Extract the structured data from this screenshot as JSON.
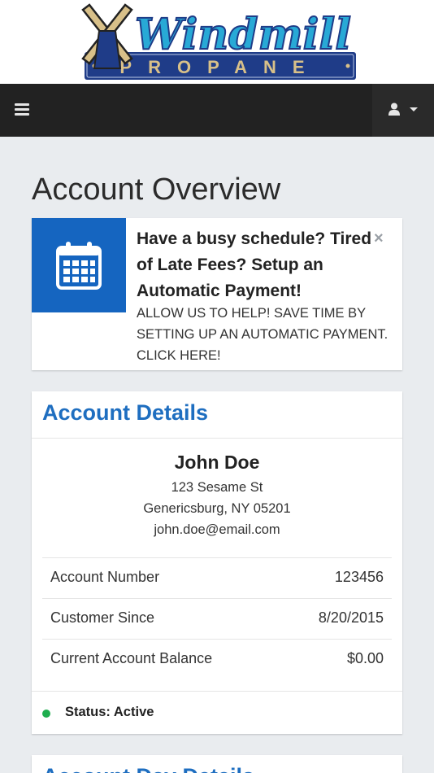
{
  "logo": {
    "word": "Windmill",
    "tagline": "PROPANE"
  },
  "nav": {
    "menu_icon": "hamburger-menu-icon",
    "user_icon": "user-icon",
    "caret_icon": "caret-down-icon"
  },
  "page": {
    "title": "Account Overview"
  },
  "promo": {
    "icon": "calendar-icon",
    "heading": "Have a busy schedule? Tired of Late Fees? Setup an Automatic Payment!",
    "subtext": "ALLOW US TO HELP! SAVE TIME BY SETTING UP AN AUTOMATIC PAYMENT. CLICK HERE!",
    "close_label": "×"
  },
  "account_details": {
    "title": "Account Details",
    "name": "John Doe",
    "address_line1": "123 Sesame St",
    "address_line2": "Genericsburg, NY 05201",
    "email": "john.doe@email.com",
    "rows": [
      {
        "label": "Account Number",
        "value": "123456"
      },
      {
        "label": "Customer Since",
        "value": "8/20/2015"
      },
      {
        "label": "Current Account Balance",
        "value": "$0.00"
      }
    ],
    "status": "Status: Active"
  },
  "next_card": {
    "title": "Account Day Details"
  },
  "colors": {
    "brand_blue": "#1e6ec0",
    "promo_blue": "#1565c0",
    "navbar": "#222222",
    "status_active": "#1fae4f"
  }
}
